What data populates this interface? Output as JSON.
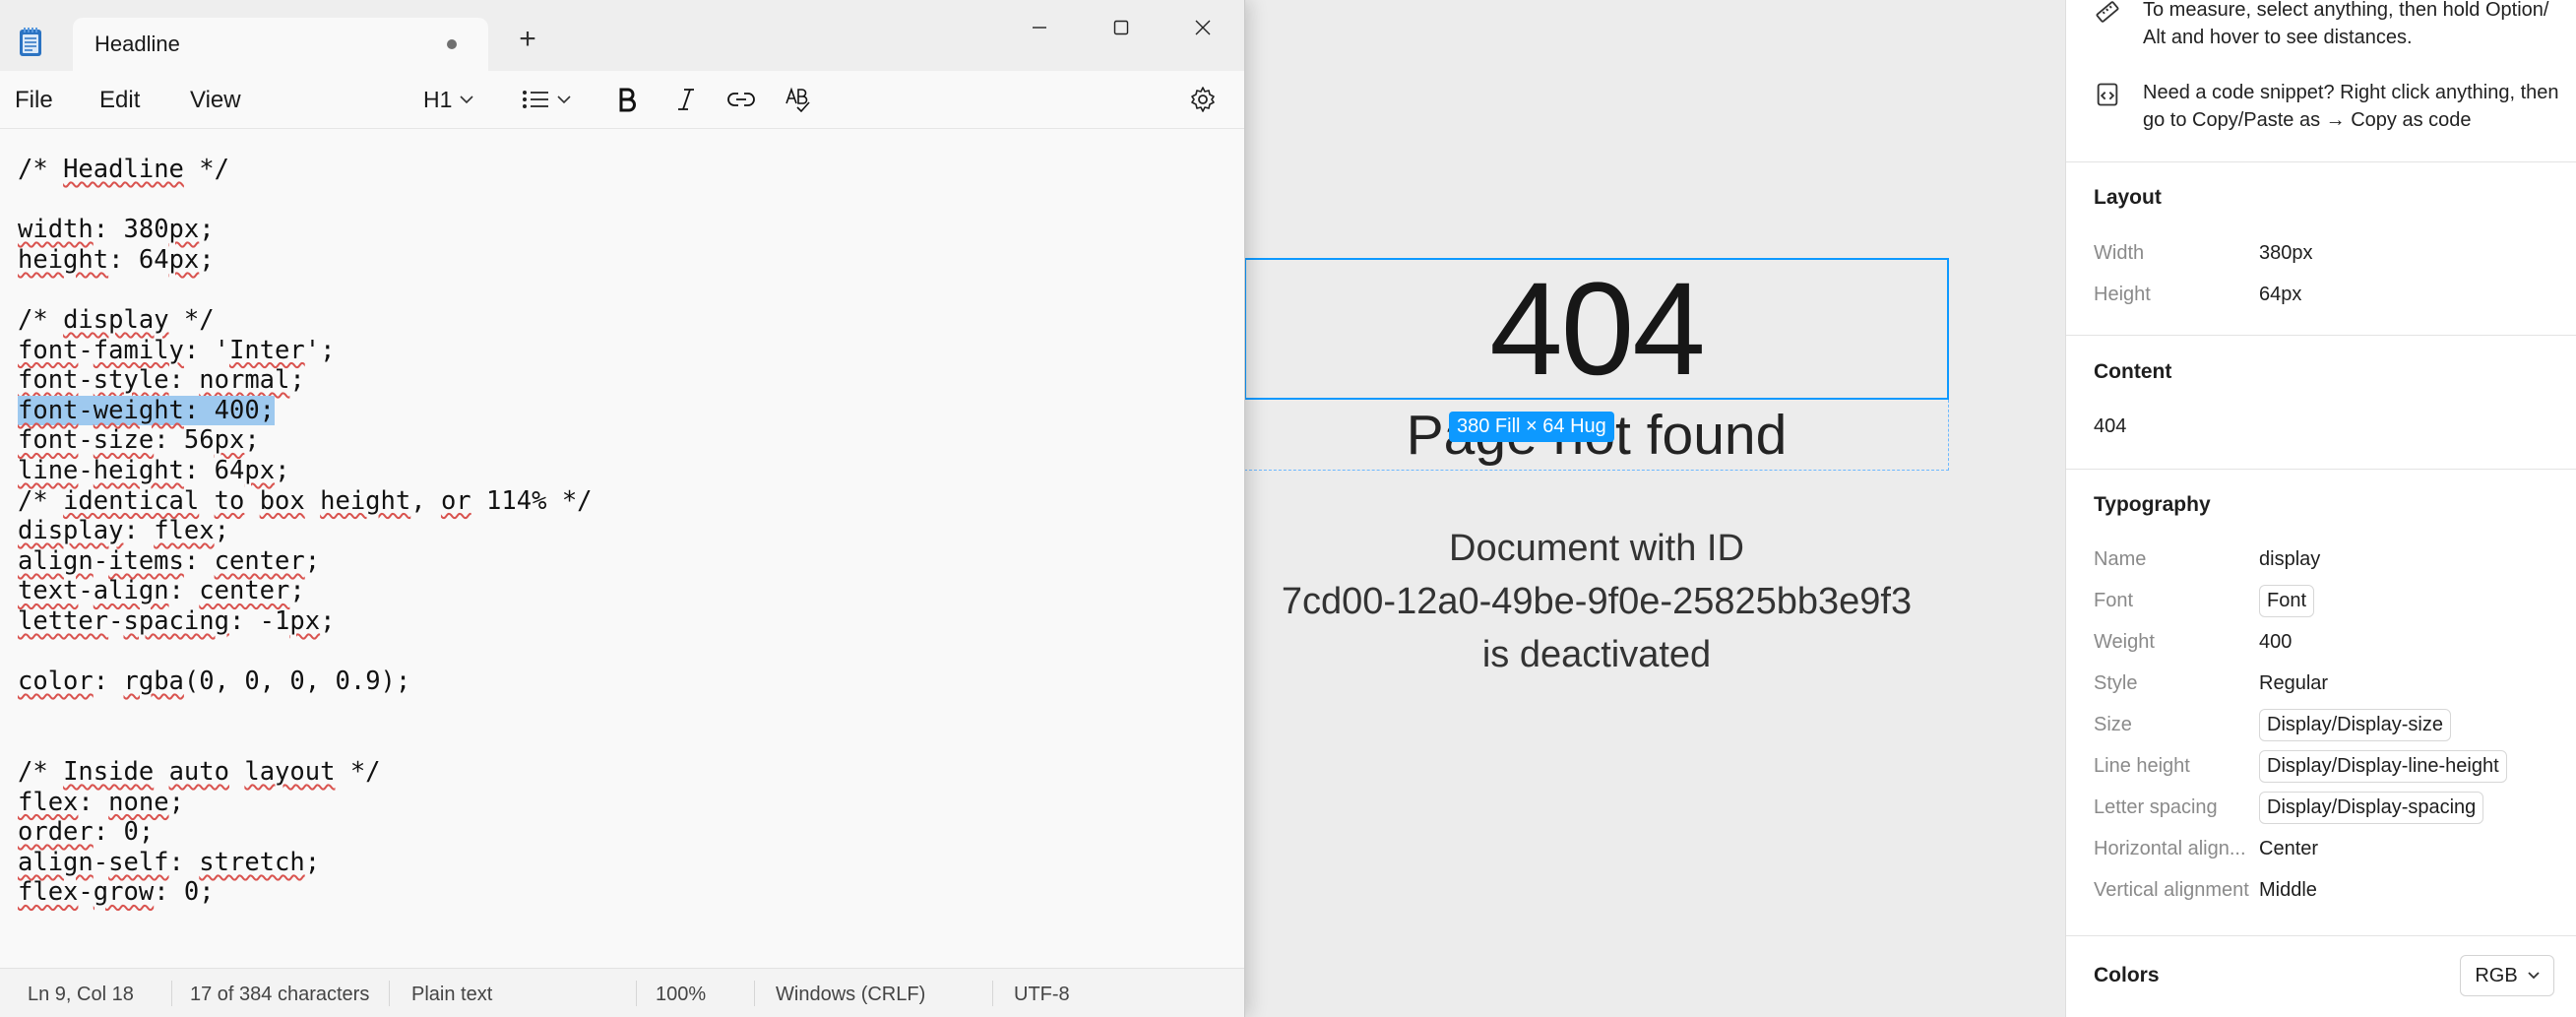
{
  "notepad": {
    "tab_title": "Headline",
    "new_tab_symbol": "+",
    "menu": {
      "file": "File",
      "edit": "Edit",
      "view": "View"
    },
    "toolbar": {
      "heading": "H1"
    },
    "code_lines": [
      "/* Headline */",
      "",
      "width: 380px;",
      "height: 64px;",
      "",
      "/* display */",
      "font-family: 'Inter';",
      "font-style: normal;",
      "font-weight: 400;",
      "font-size: 56px;",
      "line-height: 64px;",
      "/* identical to box height, or 114% */",
      "display: flex;",
      "align-items: center;",
      "text-align: center;",
      "letter-spacing: -1px;",
      "",
      "color: rgba(0, 0, 0, 0.9);",
      "",
      "",
      "/* Inside auto layout */",
      "flex: none;",
      "order: 0;",
      "align-self: stretch;",
      "flex-grow: 0;"
    ],
    "selected_line_index": 8,
    "status": {
      "position": "Ln 9, Col 18",
      "selection": "17 of 384 characters",
      "format": "Plain text",
      "zoom": "100%",
      "line_ending": "Windows (CRLF)",
      "encoding": "UTF-8"
    }
  },
  "canvas": {
    "headline": "404",
    "subtitle": "Page not found",
    "dimension_badge": "380 Fill × 64 Hug",
    "doc_line1": "Document with ID",
    "doc_line2": "7cd00-12a0-49be-9f0e-25825bb3e9f3",
    "doc_line3": "is deactivated",
    "selection_color": "#0d99ff"
  },
  "panel": {
    "tip_measure": "To measure, select anything, then hold Option/ Alt and hover to see distances.",
    "tip_snippet": "Need a code snippet? Right click anything, then go to Copy/Paste as → Copy as code",
    "layout": {
      "title": "Layout",
      "width_label": "Width",
      "width_value": "380px",
      "height_label": "Height",
      "height_value": "64px"
    },
    "content": {
      "title": "Content",
      "value": "404"
    },
    "typography": {
      "title": "Typography",
      "name_label": "Name",
      "name_value": "display",
      "font_label": "Font",
      "font_value": "Font",
      "weight_label": "Weight",
      "weight_value": "400",
      "style_label": "Style",
      "style_value": "Regular",
      "size_label": "Size",
      "size_value": "Display/Display-size",
      "line_height_label": "Line height",
      "line_height_value": "Display/Display-line-height",
      "letter_spacing_label": "Letter spacing",
      "letter_spacing_value": "Display/Display-spacing",
      "h_align_label": "Horizontal align...",
      "h_align_value": "Center",
      "v_align_label": "Vertical alignment",
      "v_align_value": "Middle"
    },
    "colors": {
      "title": "Colors",
      "mode": "RGB"
    }
  }
}
